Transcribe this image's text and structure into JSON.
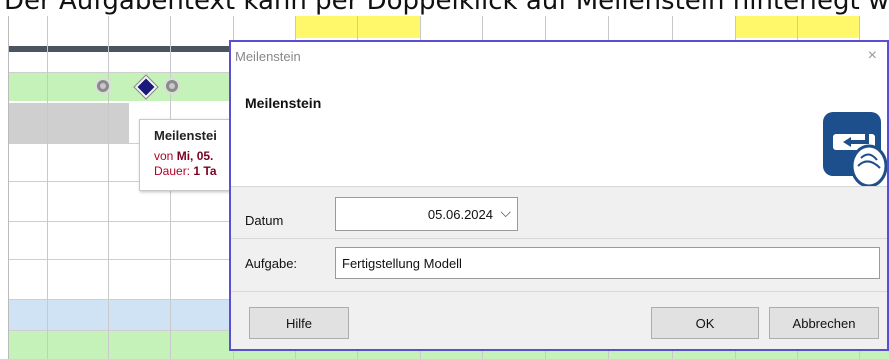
{
  "caption": "Der Aufgabentext kann per Doppelklick auf Meilenstein hinterlegt we",
  "tooltip": {
    "title": "Meilenstei",
    "line1_prefix": "von",
    "line1_value": "Mi, 05.",
    "line2_prefix": "Dauer:",
    "line2_value": "1 Ta"
  },
  "dialog": {
    "window_title": "Meilenstein",
    "close_glyph": "×",
    "heading": "Meilenstein",
    "date_label": "Datum",
    "date_value": "05.06.2024",
    "date_chevron": "⌵",
    "task_label": "Aufgabe:",
    "task_value": "Fertigstellung Modell",
    "help_button": "Hilfe",
    "ok_button": "OK",
    "cancel_button": "Abbrechen",
    "header_icon": "enter-key-finger-icon"
  },
  "colors": {
    "dialog_border": "#5a4fd0",
    "weekend_yellow": "#fff86b",
    "row_green": "#c5f2b8",
    "row_blue": "#cfe3f5",
    "milestone_navy": "#1a1a7a",
    "icon_blue": "#1c4f8c"
  }
}
